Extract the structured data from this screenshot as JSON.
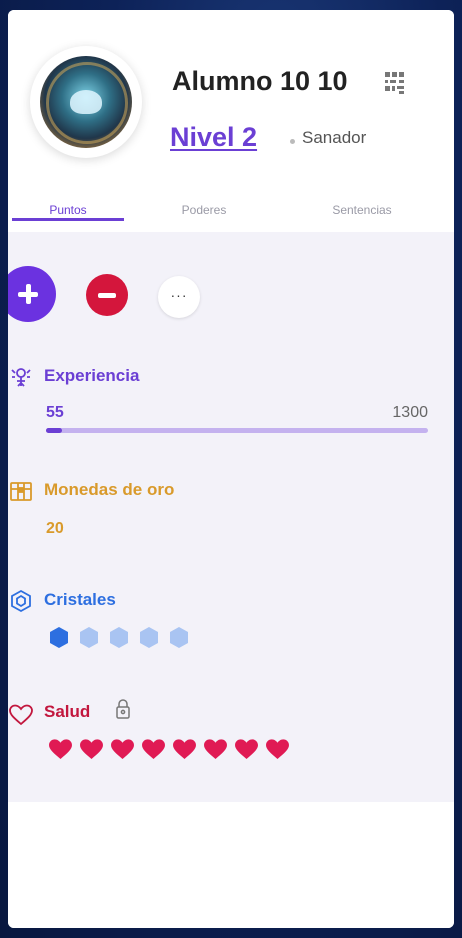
{
  "student": {
    "name": "Alumno 10 10",
    "level_label": "Nivel 2",
    "class_name": "Sanador"
  },
  "tabs": [
    "Puntos",
    "Poderes",
    "Sentencias"
  ],
  "active_tab": 0,
  "actions": {
    "add_icon": "plus-icon",
    "remove_icon": "minus-icon",
    "more_icon": "more-dots-icon"
  },
  "stats": {
    "experience": {
      "label": "Experiencia",
      "value": "55",
      "max": "1300",
      "progress_fraction": 0.042
    },
    "gold": {
      "label": "Monedas de oro",
      "value": "20"
    },
    "crystals": {
      "label": "Cristales",
      "filled": 1,
      "total": 5
    },
    "health": {
      "label": "Salud",
      "hearts": 8
    }
  },
  "colors": {
    "accent": "#6b3fd4",
    "danger": "#d4163c",
    "gold": "#d99a2b",
    "crystal": "#2d6fe0",
    "crystal_empty": "#a9c4f2",
    "health": "#e01a54"
  },
  "icons": {
    "qr": "qr-code-icon",
    "experience": "experience-icon",
    "gold": "treasure-chest-icon",
    "crystals": "crystal-icon",
    "health": "heart-outline-icon",
    "lock": "lock-icon"
  }
}
